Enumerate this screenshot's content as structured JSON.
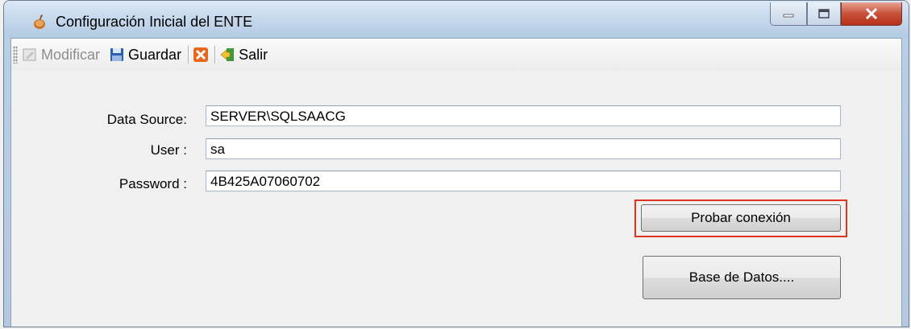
{
  "window": {
    "title": "Configuración Inicial del ENTE",
    "app_icon": "app-icon",
    "controls": [
      "minimize-icon",
      "maximize-icon",
      "close-icon"
    ]
  },
  "toolbar": {
    "modify_label": "Modificar",
    "save_label": "Guardar",
    "cancel_icon": "cancel-icon",
    "exit_label": "Salir"
  },
  "form": {
    "data_source_label": "Data Source:",
    "data_source_value": "SERVER\\SQLSAACG",
    "user_label": "User :",
    "user_value": "sa",
    "password_label": "Password :",
    "password_value": "4B425A07060702"
  },
  "buttons": {
    "test_connection": "Probar conexión",
    "database": "Base de Datos...."
  },
  "colors": {
    "highlight": "#e0341e"
  }
}
